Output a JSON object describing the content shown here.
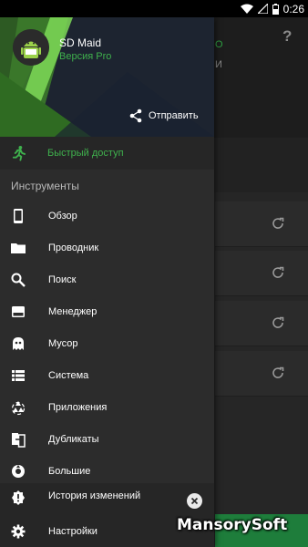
{
  "status_bar": {
    "time": "0:26"
  },
  "drawer": {
    "header": {
      "app_name": "SD Maid",
      "app_version": "Версия Pro",
      "share_label": "Отправить"
    },
    "quick_access": {
      "label": "Быстрый доступ",
      "icon": "running-person-icon"
    },
    "tools_section_title": "Инструменты",
    "items": [
      {
        "label": "Обзор",
        "icon": "phone-icon"
      },
      {
        "label": "Проводник",
        "icon": "folder-icon"
      },
      {
        "label": "Поиск",
        "icon": "search-icon"
      },
      {
        "label": "Менеджер",
        "icon": "app-manager-icon"
      },
      {
        "label": "Мусор",
        "icon": "ghost-icon"
      },
      {
        "label": "Система",
        "icon": "list-icon"
      },
      {
        "label": "Приложения",
        "icon": "recycle-icon"
      },
      {
        "label": "Дубликаты",
        "icon": "duplicates-icon"
      },
      {
        "label": "Большие",
        "icon": "large-files-icon"
      }
    ],
    "changelog_label": "История изменений",
    "settings_label": "Настройки"
  },
  "background": {
    "help_symbol": "?",
    "green_fragment": "O",
    "gray_fragment": "И"
  },
  "watermark": "MansorySoft",
  "colors": {
    "accent": "#3fb14d",
    "drawer_bg": "#2c2c2c",
    "header_bg": "#1d2430"
  }
}
